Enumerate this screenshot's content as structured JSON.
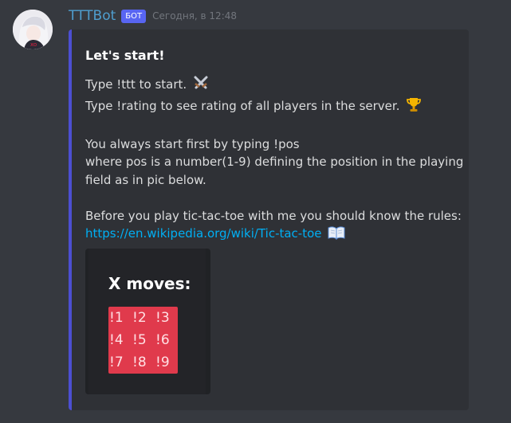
{
  "message": {
    "username": "TTTBot",
    "bot_tag": "БОТ",
    "timestamp": "Сегодня, в 12:48"
  },
  "embed": {
    "accent_color": "#4c4fd2",
    "title": "Let's start!",
    "lines": {
      "l1": "Type !ttt to start.",
      "l2": "Type !rating to see rating of all players in the server.",
      "l3": "You always start first by typing !pos",
      "l4": "where pos is a number(1-9) defining the position in the playing",
      "l5": "field as in pic below.",
      "l6": "Before you play tic-tac-toe with me you should know the rules:"
    },
    "link": "https://en.wikipedia.org/wiki/Tic-tac-toe",
    "emojis": [
      "crossed-swords-icon",
      "trophy-icon",
      "open-book-icon"
    ],
    "image": {
      "title": "X moves:",
      "cells": [
        "!1",
        "!2",
        "!3",
        "!4",
        "!5",
        "!6",
        "!7",
        "!8",
        "!9"
      ],
      "grid_color": "#e03a4c"
    }
  }
}
